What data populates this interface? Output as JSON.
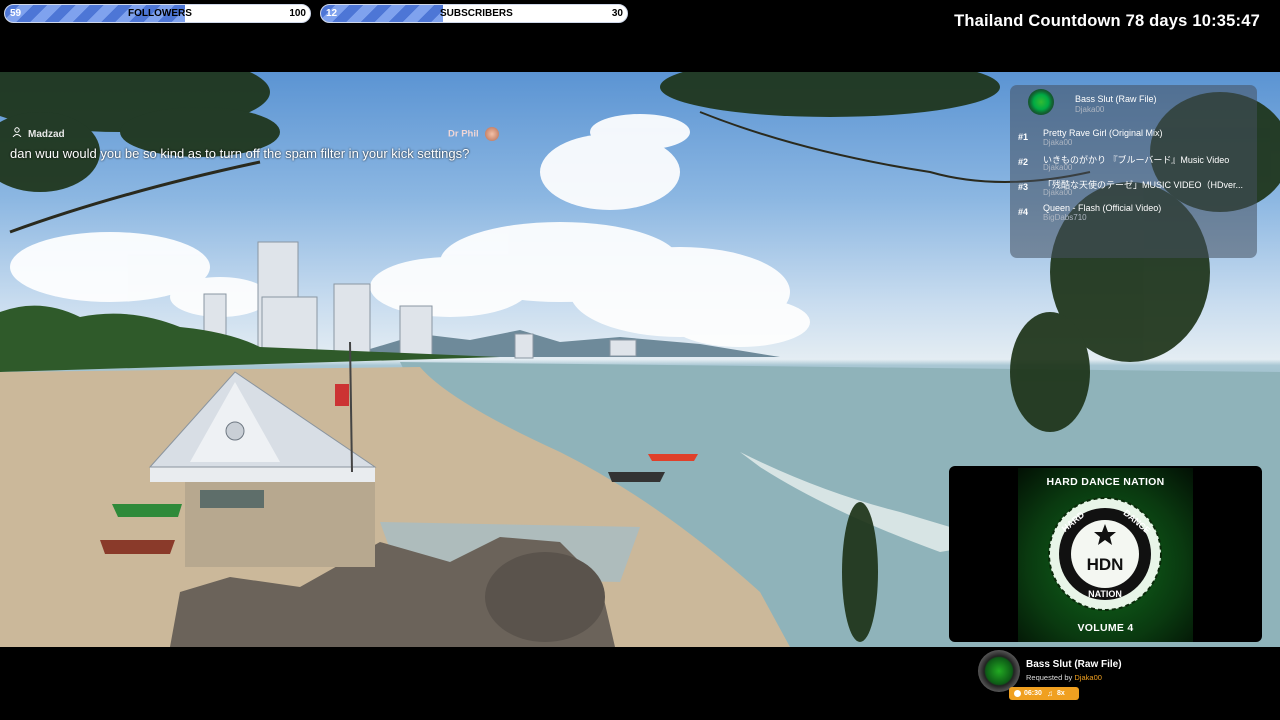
{
  "goals": {
    "followers": {
      "current": "59",
      "label": "FOLLOWERS",
      "target": "100",
      "progress": 0.59
    },
    "subscribers": {
      "current": "12",
      "label": "SUBSCRIBERS",
      "target": "30",
      "progress": 0.4
    }
  },
  "countdown": "Thailand Countdown 78 days 10:35:47",
  "chat": {
    "username": "Madzad",
    "tag": "Dr Phil",
    "message": "dan wuu would you be so kind as to turn off the spam filter in your kick settings?"
  },
  "playlist": {
    "current": {
      "title": "Bass Slut (Raw File)",
      "requester": "Djaka00"
    },
    "items": [
      {
        "num": "#1",
        "title": "Pretty Rave Girl (Original Mix)",
        "requester": "Djaka00"
      },
      {
        "num": "#2",
        "title": "いきものがかり 『ブルーバード』Music Video",
        "requester": "Djaka00"
      },
      {
        "num": "#3",
        "title": "「残酷な天使のテーゼ」MUSIC VIDEO（HDver...",
        "requester": "Djaka00"
      },
      {
        "num": "#4",
        "title": "Queen - Flash (Official Video)",
        "requester": "BigDabs710"
      }
    ]
  },
  "album": {
    "title": "HARD DANCE NATION",
    "ring_top_left": "HARD",
    "ring_top_right": "DANCE",
    "ring_bottom": "NATION",
    "logo": "HDN",
    "volume": "VOLUME 4"
  },
  "now_playing": {
    "title": "Bass Slut (Raw File)",
    "requested_prefix": "Requested by",
    "requester": "Djaka00",
    "time": "06:30",
    "count": "8x"
  },
  "colors": {
    "goal_fill": "#4d76d6",
    "accent": "#f0a020",
    "album_green": "#0f6a1c"
  }
}
